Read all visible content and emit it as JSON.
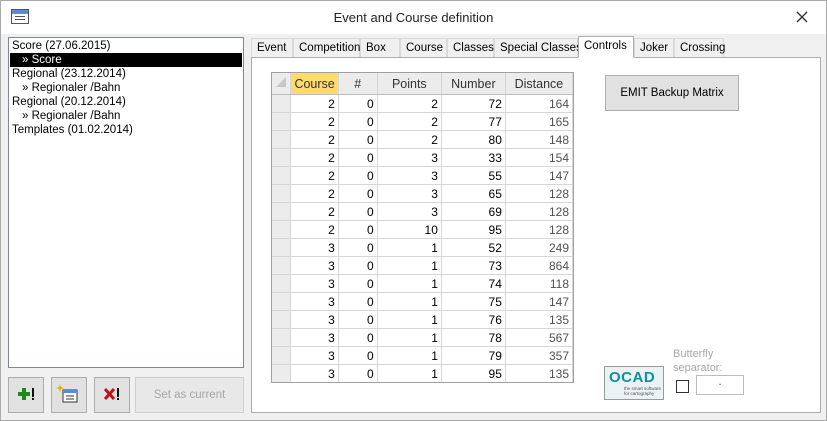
{
  "window": {
    "title": "Event and Course definition"
  },
  "tree": {
    "items": [
      {
        "label": "Score (27.06.2015)",
        "level": 0,
        "selected": false
      },
      {
        "label": "» Score",
        "level": 1,
        "selected": true
      },
      {
        "label": "Regional (23.12.2014)",
        "level": 0,
        "selected": false
      },
      {
        "label": "» Regionaler /Bahn",
        "level": 1,
        "selected": false
      },
      {
        "label": "Regional (20.12.2014)",
        "level": 0,
        "selected": false
      },
      {
        "label": "» Regionaler /Bahn",
        "level": 1,
        "selected": false
      },
      {
        "label": "Templates (01.02.2014)",
        "level": 0,
        "selected": false
      }
    ]
  },
  "buttons": {
    "set_current": "Set as current"
  },
  "tabs": [
    {
      "label": "Event"
    },
    {
      "label": "Competition"
    },
    {
      "label": "Box"
    },
    {
      "label": "Course"
    },
    {
      "label": "Classes"
    },
    {
      "label": "Special Classes"
    },
    {
      "label": "Controls",
      "active": true
    },
    {
      "label": "Joker"
    },
    {
      "label": "Crossing"
    }
  ],
  "grid": {
    "columns": [
      "Course",
      "#",
      "Points",
      "Number",
      "Distance"
    ],
    "rows": [
      [
        "2",
        "0",
        "2",
        "72",
        "164"
      ],
      [
        "2",
        "0",
        "2",
        "77",
        "165"
      ],
      [
        "2",
        "0",
        "2",
        "80",
        "148"
      ],
      [
        "2",
        "0",
        "3",
        "33",
        "154"
      ],
      [
        "2",
        "0",
        "3",
        "55",
        "147"
      ],
      [
        "2",
        "0",
        "3",
        "65",
        "128"
      ],
      [
        "2",
        "0",
        "3",
        "69",
        "128"
      ],
      [
        "2",
        "0",
        "10",
        "95",
        "128"
      ],
      [
        "3",
        "0",
        "1",
        "52",
        "249"
      ],
      [
        "3",
        "0",
        "1",
        "73",
        "864"
      ],
      [
        "3",
        "0",
        "1",
        "74",
        "118"
      ],
      [
        "3",
        "0",
        "1",
        "75",
        "147"
      ],
      [
        "3",
        "0",
        "1",
        "76",
        "135"
      ],
      [
        "3",
        "0",
        "1",
        "78",
        "567"
      ],
      [
        "3",
        "0",
        "1",
        "79",
        "357"
      ],
      [
        "3",
        "0",
        "1",
        "95",
        "135"
      ]
    ]
  },
  "controls_panel": {
    "emit_button": "EMIT Backup Matrix",
    "butterfly_label": "Butterfly separator:",
    "separator_value": ".",
    "butterfly_checked": false
  },
  "logo": {
    "word": "OCAD",
    "tagline": "the smart software for cartography"
  },
  "colors": {
    "selected_header": "#ffda6c",
    "tree_selection": "#000000",
    "ocad_teal": "#0f8f9f"
  }
}
